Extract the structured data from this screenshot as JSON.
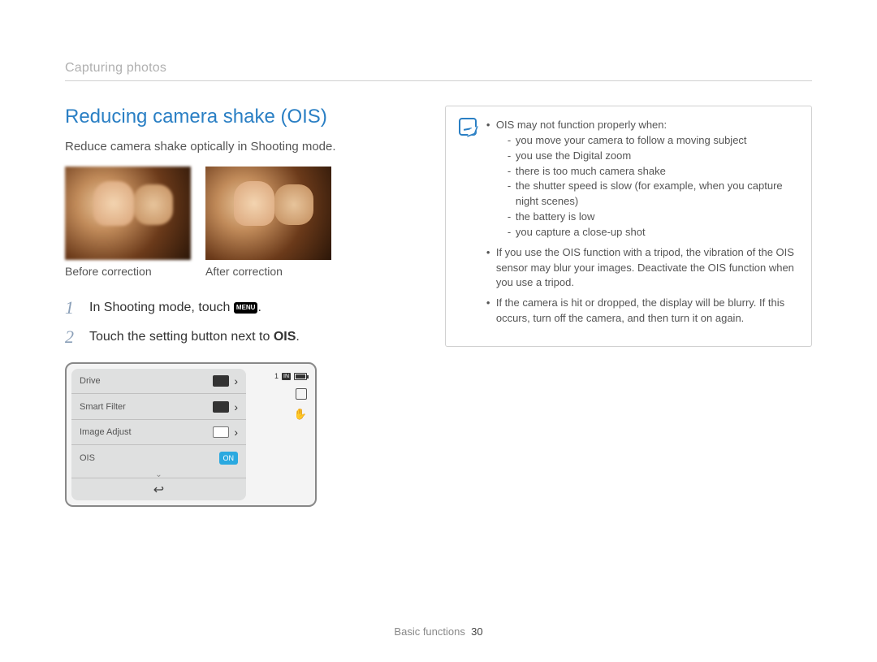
{
  "section_label": "Capturing photos",
  "heading": "Reducing camera shake (OIS)",
  "description": "Reduce camera shake optically in Shooting mode.",
  "captions": {
    "before": "Before correction",
    "after": "After correction"
  },
  "steps": {
    "s1": {
      "num": "1",
      "pre": "In Shooting mode, touch ",
      "icon": "MENU",
      "post": "."
    },
    "s2": {
      "num": "2",
      "pre": "Touch the setting button next to ",
      "bold": "OIS",
      "post": "."
    }
  },
  "menu": {
    "items": [
      "Drive",
      "Smart Filter",
      "Image Adjust",
      "OIS"
    ],
    "on_label": "ON",
    "status_count": "1",
    "status_badge": "IN"
  },
  "note": {
    "intro": "OIS may not function properly when:",
    "sub": [
      "you move your camera to follow a moving subject",
      "you use the Digital zoom",
      "there is too much camera shake",
      "the shutter speed is slow (for example, when you capture night scenes)",
      "the battery is low",
      "you capture a close-up shot"
    ],
    "b2": "If you use the OIS function with a tripod, the vibration of the OIS sensor may blur your images. Deactivate the OIS function when you use a tripod.",
    "b3": "If the camera is hit or dropped, the display will be blurry. If this occurs, turn off the camera, and then turn it on again."
  },
  "footer": {
    "section": "Basic functions",
    "page": "30"
  }
}
